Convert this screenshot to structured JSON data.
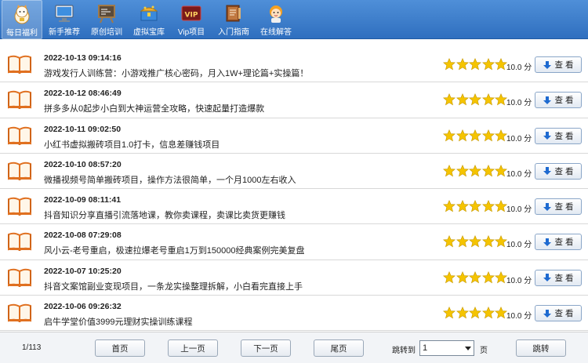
{
  "toolbar": {
    "items": [
      {
        "label": "每日福利",
        "icon": "lucky-cat-icon",
        "active": true
      },
      {
        "label": "新手推荐",
        "icon": "monitor-icon",
        "active": false
      },
      {
        "label": "原创培训",
        "icon": "chalkboard-icon",
        "active": false
      },
      {
        "label": "虚拟宝库",
        "icon": "treasure-box-icon",
        "active": false
      },
      {
        "label": "Vip项目",
        "icon": "vip-badge-icon",
        "active": false
      },
      {
        "label": "入门指南",
        "icon": "guide-book-icon",
        "active": false
      },
      {
        "label": "在线解答",
        "icon": "support-girl-icon",
        "active": false
      }
    ]
  },
  "rows": [
    {
      "date": "2022-10-13 09:14:16",
      "title": "游戏发行人训练营：小游戏推广核心密码，月入1W+理论篇+实操篇！",
      "stars": 5,
      "score": "10.0 分",
      "button": "查 看"
    },
    {
      "date": "2022-10-12 08:46:49",
      "title": "拼多多从0起步小白到大神运营全攻略，快速起量打造爆款",
      "stars": 5,
      "score": "10.0 分",
      "button": "查 看"
    },
    {
      "date": "2022-10-11 09:02:50",
      "title": "小红书虚拟搬砖项目1.0打卡，信息差赚钱项目",
      "stars": 5,
      "score": "10.0 分",
      "button": "查 看"
    },
    {
      "date": "2022-10-10 08:57:20",
      "title": "微播视频号简单搬砖项目，操作方法很简单，一个月1000左右收入",
      "stars": 5,
      "score": "10.0 分",
      "button": "查 看"
    },
    {
      "date": "2022-10-09 08:11:41",
      "title": "抖音知识分享直播引流落地课，教你卖课程，卖课比卖货更赚钱",
      "stars": 5,
      "score": "10.0 分",
      "button": "查 看"
    },
    {
      "date": "2022-10-08 07:29:08",
      "title": "风小云-老号重启，极速拉爆老号重启1万到150000经典案例完美复盘",
      "stars": 5,
      "score": "10.0 分",
      "button": "查 看"
    },
    {
      "date": "2022-10-07 10:25:20",
      "title": "抖音文案馆副业变现项目，一条龙实操整理拆解，小白看完直接上手",
      "stars": 5,
      "score": "10.0 分",
      "button": "查 看"
    },
    {
      "date": "2022-10-06 09:26:32",
      "title": "启牛学堂价值3999元理财实操训练课程",
      "stars": 5,
      "score": "10.0 分",
      "button": "查 看"
    }
  ],
  "pager": {
    "info": "1/113",
    "first": "首页",
    "prev": "上一页",
    "next": "下一页",
    "last": "尾页",
    "jump_label": "跳转到",
    "page_value": "1",
    "page_unit": "页",
    "go": "跳转"
  },
  "colors": {
    "toolbar": "#3a7bcc",
    "star": "#f5c400",
    "book": "#e07020"
  }
}
